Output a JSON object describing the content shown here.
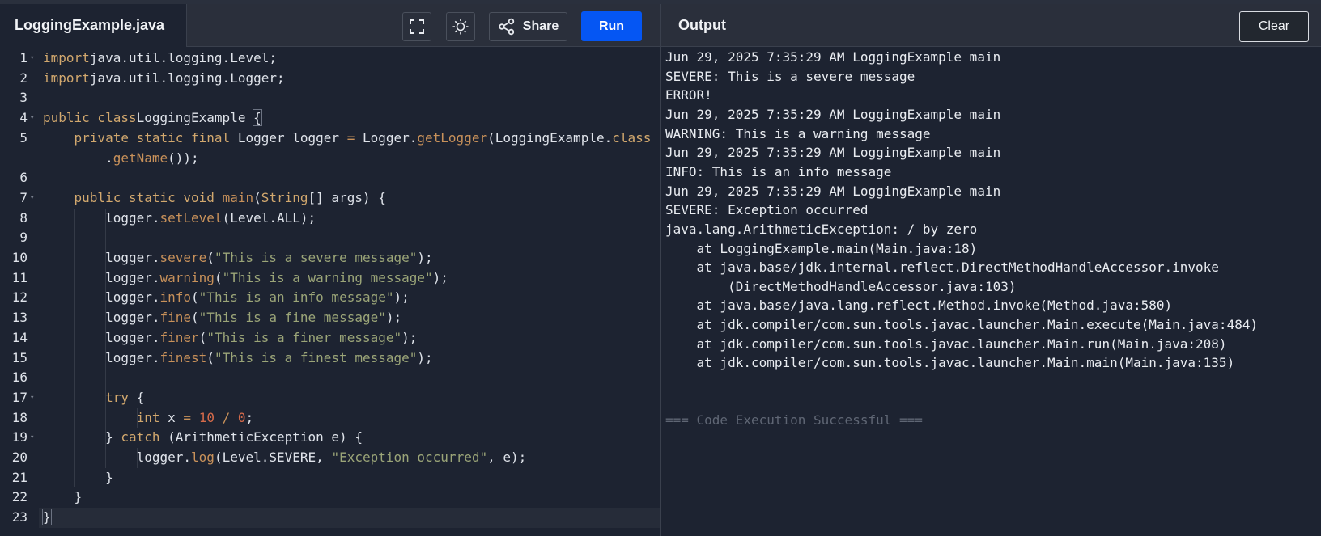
{
  "editor": {
    "file_name": "LoggingExample.java",
    "share_label": "Share",
    "run_label": "Run"
  },
  "output": {
    "title": "Output",
    "clear_label": "Clear",
    "lines": [
      "Jun 29, 2025 7:35:29 AM LoggingExample main",
      "SEVERE: This is a severe message",
      "ERROR!",
      "Jun 29, 2025 7:35:29 AM LoggingExample main",
      "WARNING: This is a warning message",
      "Jun 29, 2025 7:35:29 AM LoggingExample main",
      "INFO: This is an info message",
      "Jun 29, 2025 7:35:29 AM LoggingExample main",
      "SEVERE: Exception occurred",
      "java.lang.ArithmeticException: / by zero",
      "    at LoggingExample.main(Main.java:18)",
      "    at java.base/jdk.internal.reflect.DirectMethodHandleAccessor.invoke",
      "        (DirectMethodHandleAccessor.java:103)",
      "    at java.base/java.lang.reflect.Method.invoke(Method.java:580)",
      "    at jdk.compiler/com.sun.tools.javac.launcher.Main.execute(Main.java:484)",
      "    at jdk.compiler/com.sun.tools.javac.launcher.Main.run(Main.java:208)",
      "    at jdk.compiler/com.sun.tools.javac.launcher.Main.main(Main.java:135)",
      "",
      "",
      "=== Code Execution Successful ==="
    ]
  },
  "code": {
    "line_numbers": [
      "1",
      "2",
      "3",
      "4",
      "5",
      "",
      "6",
      "7",
      "8",
      "9",
      "10",
      "11",
      "12",
      "13",
      "14",
      "15",
      "16",
      "17",
      "18",
      "19",
      "20",
      "21",
      "22",
      "23"
    ],
    "fold_markers": [
      "1",
      "4",
      "7",
      "17",
      "19"
    ],
    "lines": [
      [
        [
          "kw",
          "import"
        ],
        [
          "",
          "java.util.logging.Level;"
        ]
      ],
      [
        [
          "kw",
          "import"
        ],
        [
          "",
          "java.util.logging.Logger;"
        ]
      ],
      [],
      [
        [
          "kw",
          "public class"
        ],
        [
          "",
          "LoggingExample "
        ],
        [
          "br",
          "{"
        ]
      ],
      [
        [
          "",
          "    "
        ],
        [
          "kw",
          "private static final"
        ],
        [
          "",
          " Logger logger "
        ],
        [
          "op",
          "="
        ],
        [
          "",
          " Logger."
        ],
        [
          "fn",
          "getLogger"
        ],
        [
          "",
          "(LoggingExample."
        ],
        [
          "kw",
          "class"
        ]
      ],
      [
        [
          "",
          "        ."
        ],
        [
          "fn",
          "getName"
        ],
        [
          "",
          "());"
        ]
      ],
      [],
      [
        [
          "",
          "    "
        ],
        [
          "kw",
          "public static void"
        ],
        [
          "",
          " "
        ],
        [
          "fn",
          "main"
        ],
        [
          "",
          "("
        ],
        [
          "kw",
          "String"
        ],
        [
          "",
          "[] args) {"
        ]
      ],
      [
        [
          "",
          "        logger."
        ],
        [
          "fn",
          "setLevel"
        ],
        [
          "",
          "(Level.ALL);"
        ]
      ],
      [],
      [
        [
          "",
          "        logger."
        ],
        [
          "fn",
          "severe"
        ],
        [
          "",
          "("
        ],
        [
          "str",
          "\"This is a severe message\""
        ],
        [
          "",
          ");"
        ]
      ],
      [
        [
          "",
          "        logger."
        ],
        [
          "fn",
          "warning"
        ],
        [
          "",
          "("
        ],
        [
          "str",
          "\"This is a warning message\""
        ],
        [
          "",
          ");"
        ]
      ],
      [
        [
          "",
          "        logger."
        ],
        [
          "fn",
          "info"
        ],
        [
          "",
          "("
        ],
        [
          "str",
          "\"This is an info message\""
        ],
        [
          "",
          ");"
        ]
      ],
      [
        [
          "",
          "        logger."
        ],
        [
          "fn",
          "fine"
        ],
        [
          "",
          "("
        ],
        [
          "str",
          "\"This is a fine message\""
        ],
        [
          "",
          ");"
        ]
      ],
      [
        [
          "",
          "        logger."
        ],
        [
          "fn",
          "finer"
        ],
        [
          "",
          "("
        ],
        [
          "str",
          "\"This is a finer message\""
        ],
        [
          "",
          ");"
        ]
      ],
      [
        [
          "",
          "        logger."
        ],
        [
          "fn",
          "finest"
        ],
        [
          "",
          "("
        ],
        [
          "str",
          "\"This is a finest message\""
        ],
        [
          "",
          ");"
        ]
      ],
      [],
      [
        [
          "",
          "        "
        ],
        [
          "kw",
          "try"
        ],
        [
          "",
          " {"
        ]
      ],
      [
        [
          "",
          "            "
        ],
        [
          "kw",
          "int"
        ],
        [
          "",
          " x "
        ],
        [
          "op",
          "="
        ],
        [
          "",
          " "
        ],
        [
          "num",
          "10"
        ],
        [
          "",
          " "
        ],
        [
          "op",
          "/"
        ],
        [
          "",
          " "
        ],
        [
          "num",
          "0"
        ],
        [
          "",
          ";"
        ]
      ],
      [
        [
          "",
          "        } "
        ],
        [
          "kw",
          "catch"
        ],
        [
          "",
          " (ArithmeticException e) {"
        ]
      ],
      [
        [
          "",
          "            logger."
        ],
        [
          "fn",
          "log"
        ],
        [
          "",
          "(Level.SEVERE, "
        ],
        [
          "str",
          "\"Exception occurred\""
        ],
        [
          "",
          ", e);"
        ]
      ],
      [
        [
          "",
          "        }"
        ]
      ],
      [
        [
          "",
          "    }"
        ]
      ],
      [
        [
          "br",
          "}"
        ]
      ]
    ]
  }
}
